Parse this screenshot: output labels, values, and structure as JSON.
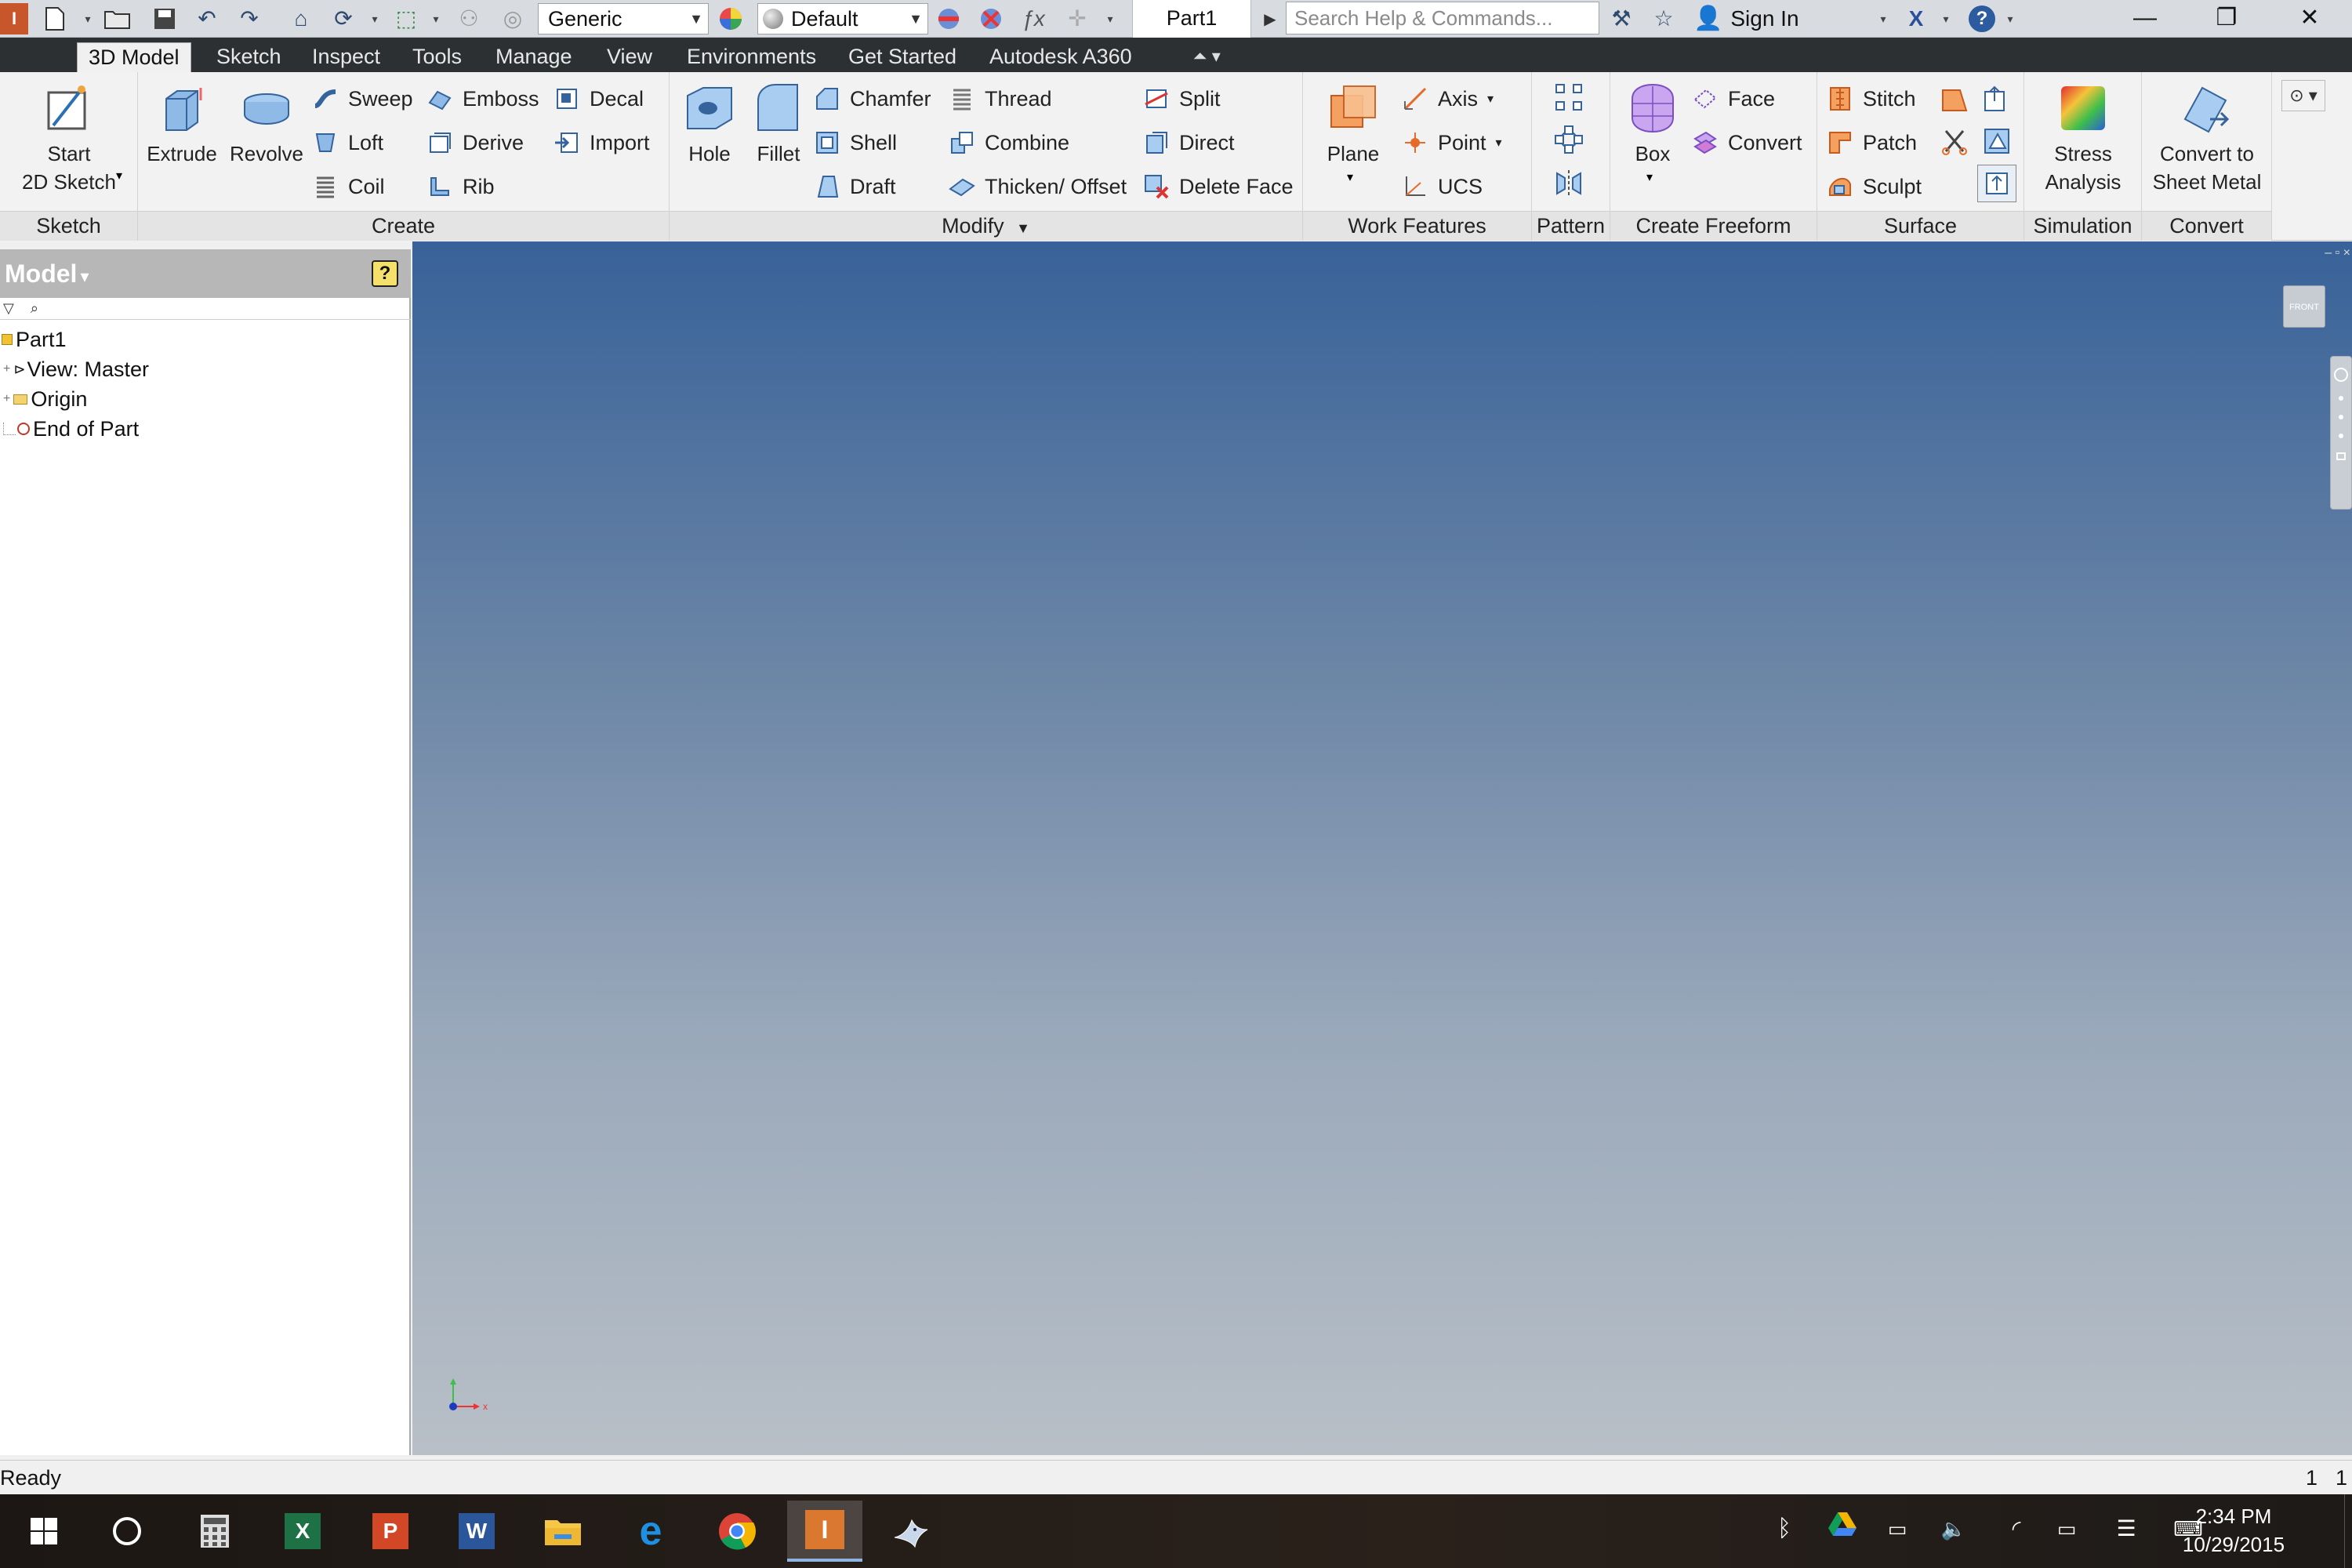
{
  "titlebar": {
    "material": "Generic",
    "appearance": "Default",
    "doc_tab": "Part1",
    "search_placeholder": "Search Help & Commands...",
    "sign_in": "Sign In"
  },
  "ribbon_tabs": [
    "3D Model",
    "Sketch",
    "Inspect",
    "Tools",
    "Manage",
    "View",
    "Environments",
    "Get Started",
    "Autodesk A360"
  ],
  "panels": {
    "sketch": {
      "title": "Sketch",
      "start_line1": "Start",
      "start_line2": "2D Sketch"
    },
    "create": {
      "title": "Create",
      "extrude": "Extrude",
      "revolve": "Revolve",
      "sweep": "Sweep",
      "loft": "Loft",
      "coil": "Coil",
      "emboss": "Emboss",
      "derive": "Derive",
      "rib": "Rib",
      "decal": "Decal",
      "import": "Import"
    },
    "modify": {
      "title": "Modify",
      "hole": "Hole",
      "fillet": "Fillet",
      "chamfer": "Chamfer",
      "shell": "Shell",
      "draft": "Draft",
      "thread": "Thread",
      "combine": "Combine",
      "thicken": "Thicken/ Offset",
      "split": "Split",
      "direct": "Direct",
      "delete_face": "Delete Face"
    },
    "work_features": {
      "title": "Work Features",
      "plane": "Plane",
      "axis": "Axis",
      "point": "Point",
      "ucs": "UCS"
    },
    "pattern": {
      "title": "Pattern"
    },
    "freeform": {
      "title": "Create Freeform",
      "box": "Box",
      "face": "Face",
      "convert": "Convert"
    },
    "surface": {
      "title": "Surface",
      "stitch": "Stitch",
      "patch": "Patch",
      "sculpt": "Sculpt"
    },
    "simulation": {
      "title": "Simulation",
      "stress_line1": "Stress",
      "stress_line2": "Analysis"
    },
    "convert": {
      "title": "Convert",
      "csm_line1": "Convert to",
      "csm_line2": "Sheet Metal"
    }
  },
  "browser": {
    "title": "Model",
    "items": [
      "Part1",
      "View: Master",
      "Origin",
      "End of Part"
    ]
  },
  "viewport": {
    "viewcube_label": "FRONT"
  },
  "status": {
    "text": "Ready",
    "count1": "1",
    "count2": "1"
  },
  "clock": {
    "time": "2:34 PM",
    "date": "10/29/2015"
  },
  "colors": {
    "viewport_top": "#386299",
    "viewport_bottom": "#b8bfc7",
    "ribbon_tab_bar": "#2d3033"
  }
}
